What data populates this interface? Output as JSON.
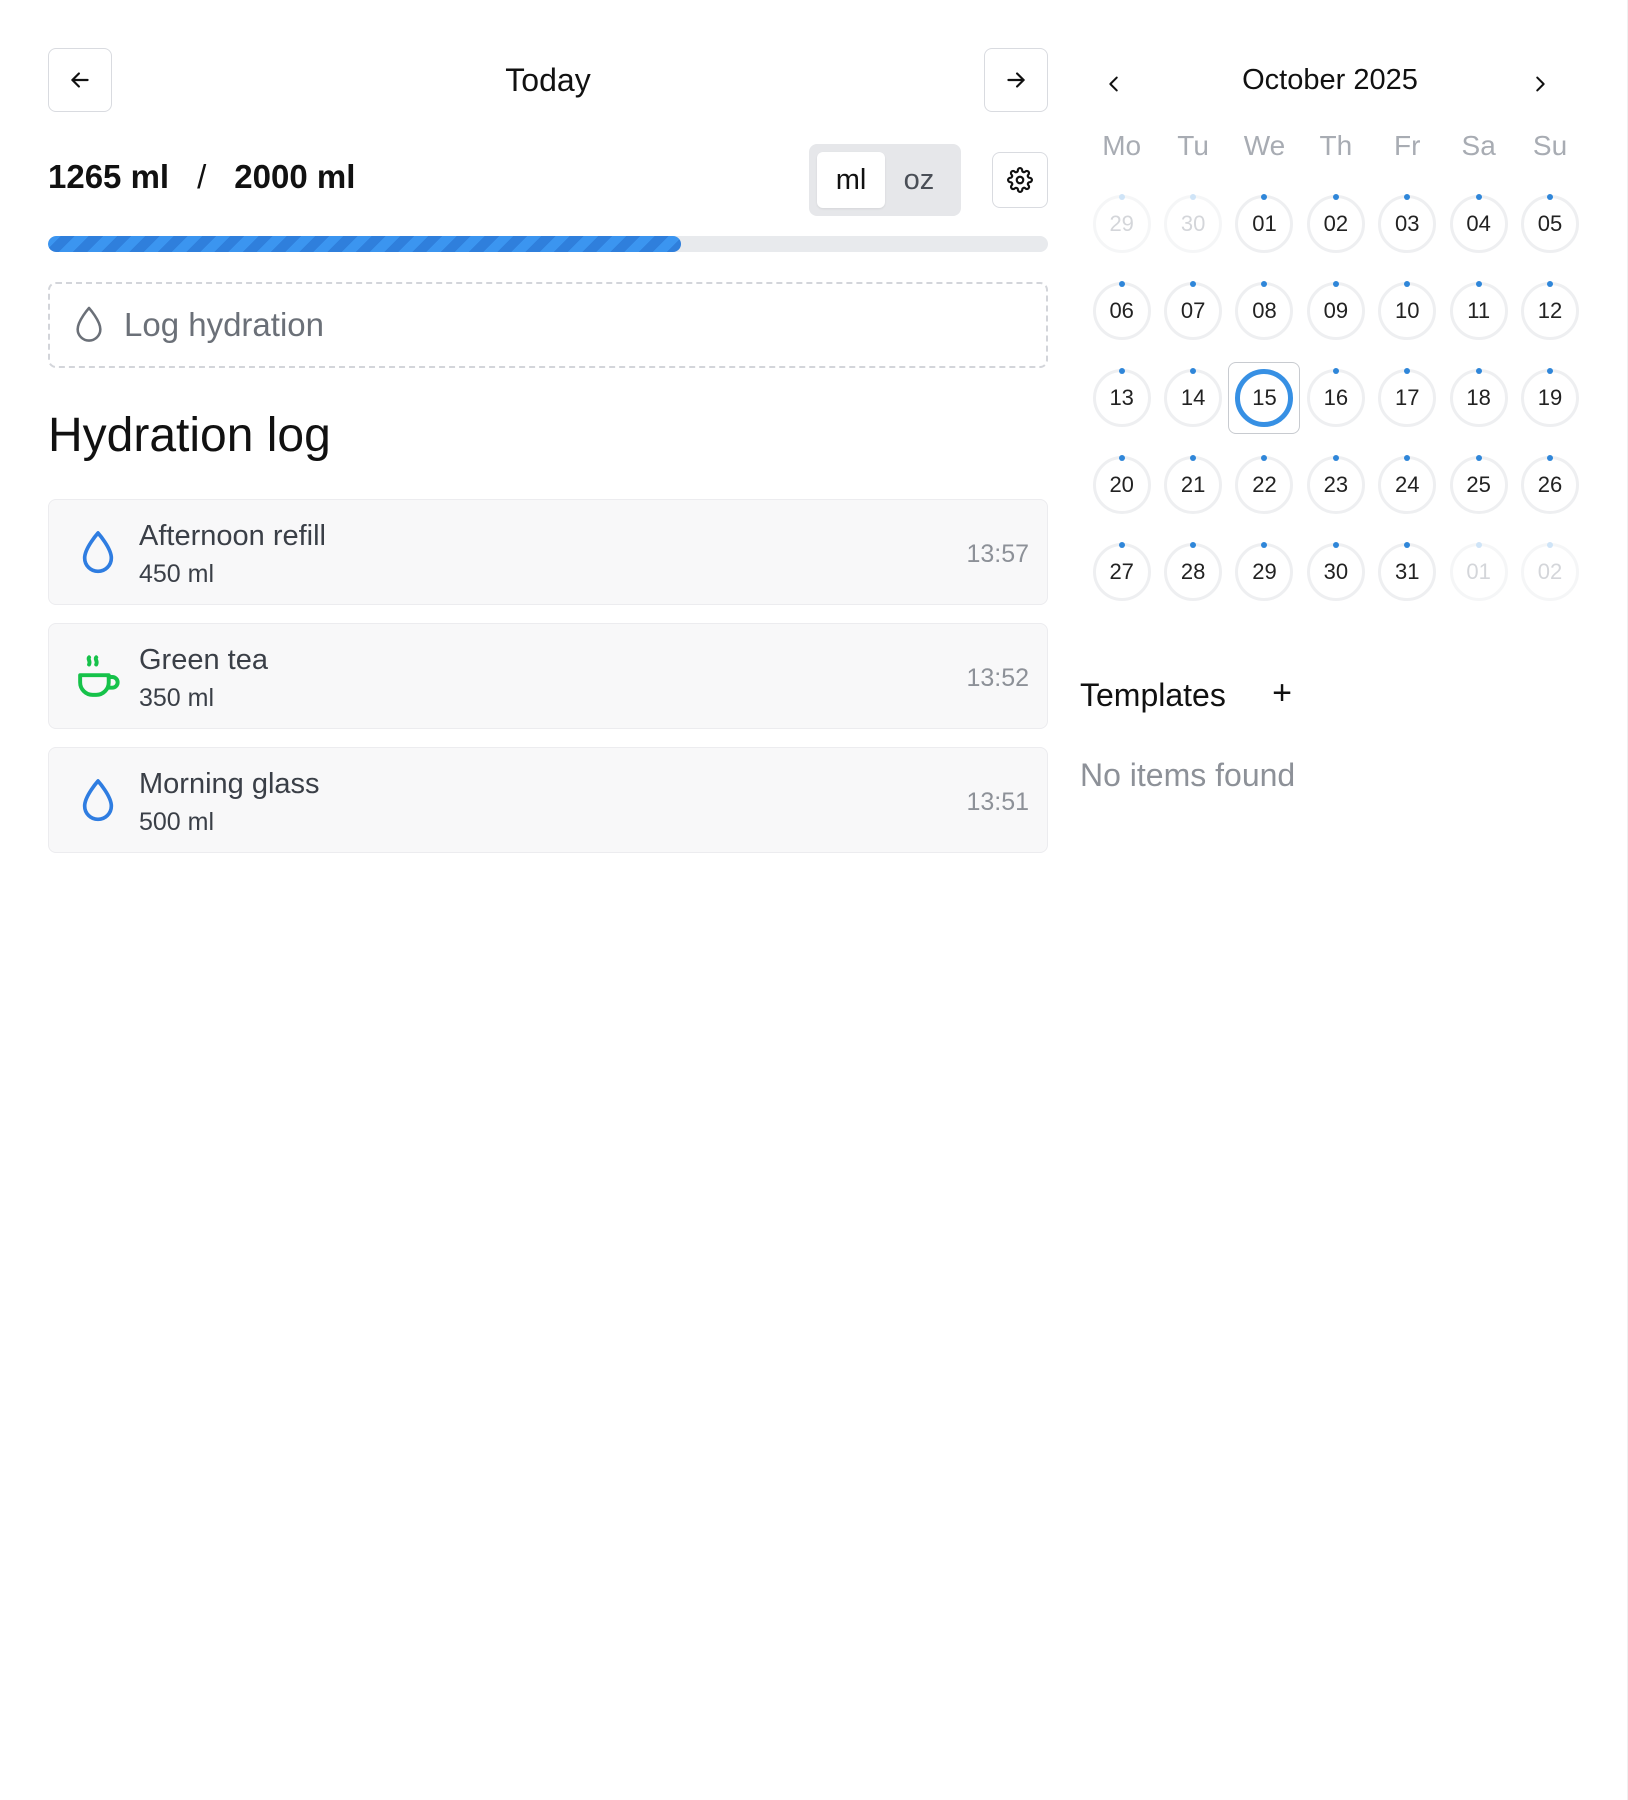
{
  "header": {
    "title": "Today"
  },
  "totals": {
    "consumed": "1265 ml",
    "separator": "/",
    "goal": "2000 ml",
    "progress_fraction": 0.6325
  },
  "units": {
    "options": [
      "ml",
      "oz"
    ],
    "selected": "ml"
  },
  "log_input": {
    "label": "Log hydration"
  },
  "log_section": {
    "title": "Hydration log"
  },
  "entries": [
    {
      "name": "Afternoon refill",
      "amount": "450 ml",
      "time": "13:57",
      "icon": "water-drop-icon",
      "color": "#2f7de1"
    },
    {
      "name": "Green tea",
      "amount": "350 ml",
      "time": "13:52",
      "icon": "tea-cup-icon",
      "color": "#16c24a"
    },
    {
      "name": "Morning glass",
      "amount": "500 ml",
      "time": "13:51",
      "icon": "water-drop-icon",
      "color": "#2f7de1"
    }
  ],
  "calendar": {
    "title": "October 2025",
    "weekdays": [
      "Mo",
      "Tu",
      "We",
      "Th",
      "Fr",
      "Sa",
      "Su"
    ],
    "days": [
      {
        "label": "29",
        "outside": true
      },
      {
        "label": "30",
        "outside": true
      },
      {
        "label": "01"
      },
      {
        "label": "02"
      },
      {
        "label": "03"
      },
      {
        "label": "04"
      },
      {
        "label": "05"
      },
      {
        "label": "06"
      },
      {
        "label": "07"
      },
      {
        "label": "08"
      },
      {
        "label": "09"
      },
      {
        "label": "10"
      },
      {
        "label": "11"
      },
      {
        "label": "12"
      },
      {
        "label": "13"
      },
      {
        "label": "14"
      },
      {
        "label": "15",
        "today": true
      },
      {
        "label": "16"
      },
      {
        "label": "17"
      },
      {
        "label": "18"
      },
      {
        "label": "19"
      },
      {
        "label": "20"
      },
      {
        "label": "21"
      },
      {
        "label": "22"
      },
      {
        "label": "23"
      },
      {
        "label": "24"
      },
      {
        "label": "25"
      },
      {
        "label": "26"
      },
      {
        "label": "27"
      },
      {
        "label": "28"
      },
      {
        "label": "29"
      },
      {
        "label": "30"
      },
      {
        "label": "31"
      },
      {
        "label": "01",
        "outside": true
      },
      {
        "label": "02",
        "outside": true
      }
    ]
  },
  "templates": {
    "title": "Templates",
    "add_label": "+",
    "empty_text": "No items found"
  },
  "colors": {
    "accent": "#3790e4",
    "progress": "#2f7fdc",
    "tea": "#16c24a",
    "water": "#2f7de1"
  }
}
